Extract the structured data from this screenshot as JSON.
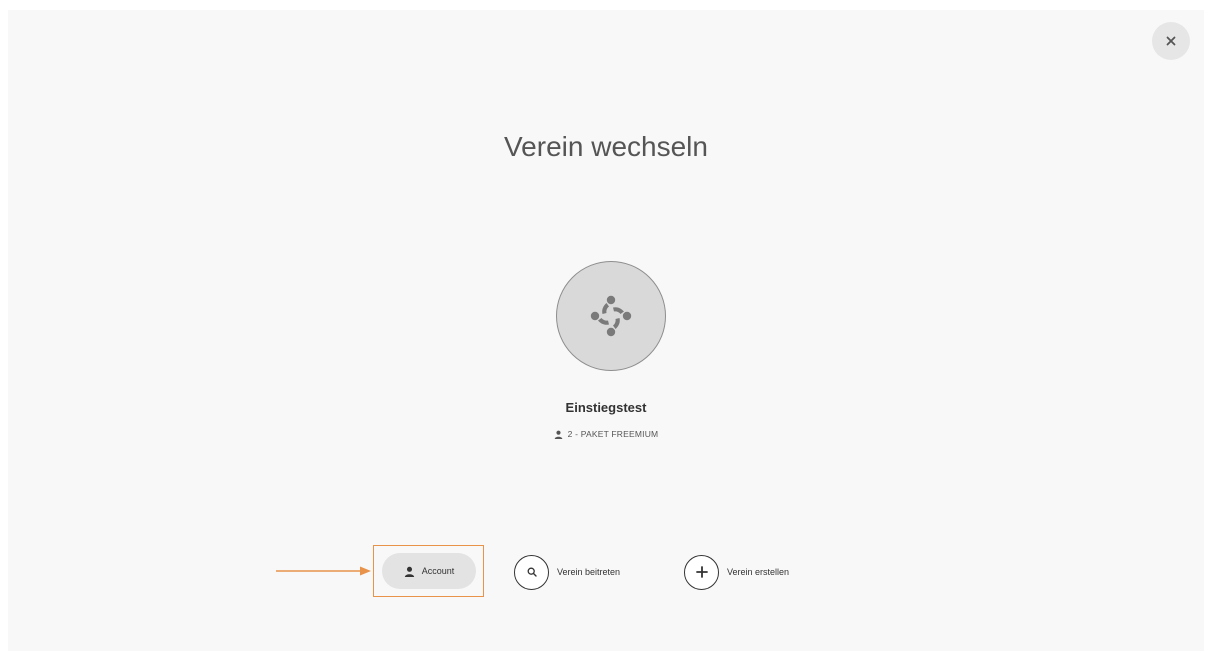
{
  "dialog": {
    "title": "Verein wechseln",
    "close_icon": "close-icon"
  },
  "club": {
    "icon": "club-logo-icon",
    "name": "Einstiegstest",
    "meta_icon": "person-icon",
    "meta": "2 - PAKET FREEMIUM"
  },
  "actions": {
    "account_label": "Account",
    "account_icon": "person-icon",
    "join_label": "Verein beitreten",
    "join_icon": "search-icon",
    "create_label": "Verein erstellen",
    "create_icon": "plus-icon"
  },
  "annotation": {
    "color": "#e8924a"
  }
}
